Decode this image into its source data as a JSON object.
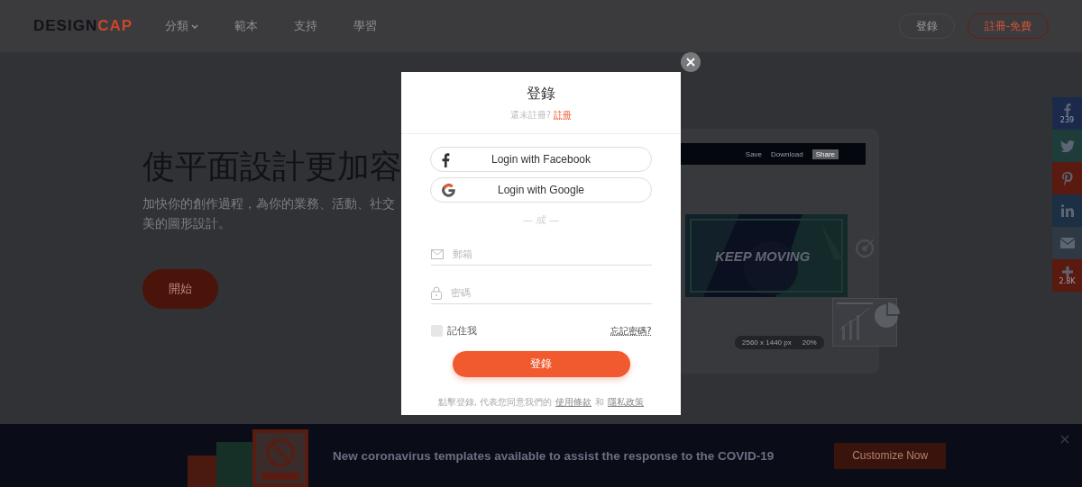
{
  "header": {
    "logo": {
      "part_1": "DESIGN",
      "part_2": "CAP"
    },
    "nav": [
      {
        "label": "分類",
        "dropdown": true
      },
      {
        "label": "範本",
        "dropdown": false
      },
      {
        "label": "支持",
        "dropdown": false
      },
      {
        "label": "學習",
        "dropdown": false
      }
    ],
    "login_button": "登錄",
    "signup_button": "註冊-免費"
  },
  "hero": {
    "title": "使平面設計更加容",
    "subtitle": "加快你的創作過程，為你的業務、活動、社交",
    "subtitle_2": "美的圖形設計。",
    "cta": "開始",
    "mockup": {
      "toolbar": [
        "Save",
        "Download",
        "Share"
      ],
      "headline": "KEEP MOVING",
      "size": "2560 x 1440 px",
      "zoom": "20%"
    }
  },
  "share_bar": [
    {
      "kind": "facebook",
      "color": "#1b2a4a",
      "count": "239"
    },
    {
      "kind": "twitter",
      "color": "#1e3d3a"
    },
    {
      "kind": "pinterest",
      "color": "#5a1a10"
    },
    {
      "kind": "linkedin",
      "color": "#1c2f44"
    },
    {
      "kind": "email",
      "color": "#2e3944"
    },
    {
      "kind": "plus",
      "color": "#5a1a10",
      "count": "2.8K"
    }
  ],
  "banner": {
    "message": "New coronavirus templates available to assist the response to the COVID-19",
    "button": "Customize Now"
  },
  "dialog": {
    "title": "登錄",
    "prompt": "還未註冊?",
    "signup_link": "註冊",
    "social_logins": [
      {
        "kind": "facebook",
        "label": "Login with Facebook"
      },
      {
        "kind": "google",
        "label": "Login with Google"
      }
    ],
    "separator": "— 或 —",
    "fields": [
      {
        "kind": "email",
        "placeholder": "郵箱"
      },
      {
        "kind": "password",
        "placeholder": "密碼"
      }
    ],
    "remember": {
      "label": "記住我",
      "checked": false
    },
    "forgot_link": "忘記密碼?",
    "submit": "登錄",
    "terms": {
      "text": "點擊登錄, 代表您同意我們的",
      "link_1": "使用條款",
      "joiner": "和",
      "link_2": "隱私政策"
    }
  }
}
